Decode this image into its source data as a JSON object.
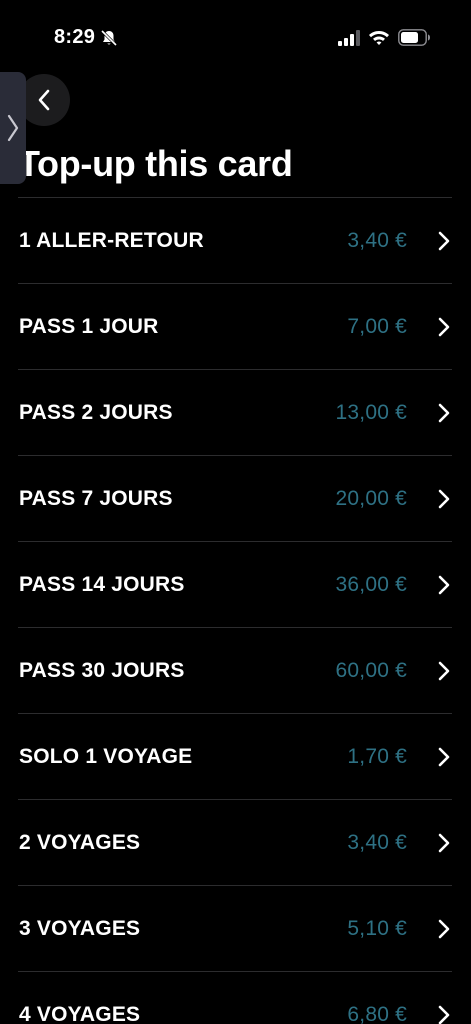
{
  "status_bar": {
    "time": "8:29",
    "icons": [
      "bell-off-icon",
      "signal-icon",
      "wifi-icon",
      "battery-icon"
    ]
  },
  "navigation": {
    "back_icon": "chevron-left-icon",
    "side_tab_icon": "chevron-right-icon"
  },
  "page": {
    "title": "Top-up this card"
  },
  "colors": {
    "background": "#000000",
    "text": "#ffffff",
    "price": "#2e7184",
    "separator": "#2c2c2e"
  },
  "products": [
    {
      "label": "1 ALLER-RETOUR",
      "price": "3,40 €"
    },
    {
      "label": "PASS 1 JOUR",
      "price": "7,00 €"
    },
    {
      "label": "PASS 2 JOURS",
      "price": "13,00 €"
    },
    {
      "label": "PASS 7 JOURS",
      "price": "20,00 €"
    },
    {
      "label": "PASS 14 JOURS",
      "price": "36,00 €"
    },
    {
      "label": "PASS 30 JOURS",
      "price": "60,00 €"
    },
    {
      "label": "SOLO 1 VOYAGE",
      "price": "1,70 €"
    },
    {
      "label": "2 VOYAGES",
      "price": "3,40 €"
    },
    {
      "label": "3 VOYAGES",
      "price": "5,10 €"
    },
    {
      "label": "4 VOYAGES",
      "price": "6,80 €"
    }
  ]
}
